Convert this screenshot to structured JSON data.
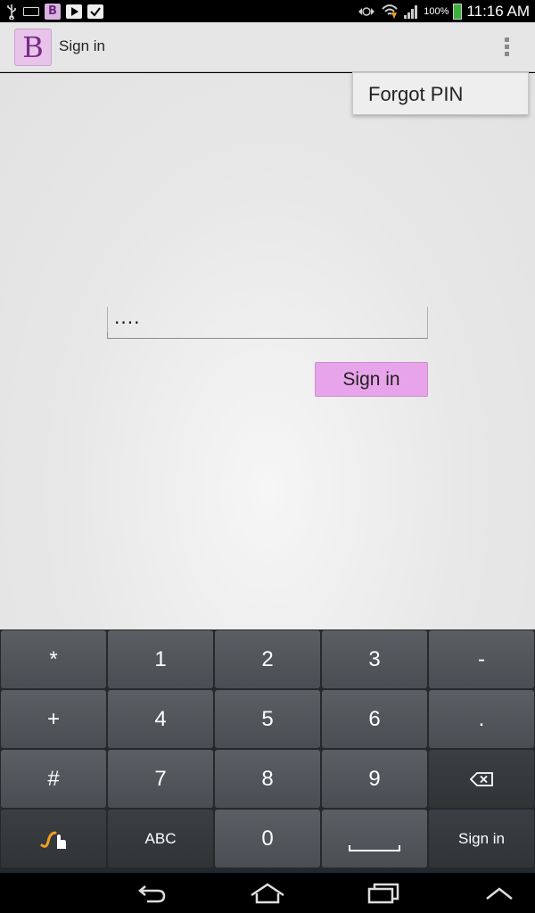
{
  "status_bar": {
    "battery_percent": "100%",
    "time": "11:16 AM",
    "icons": [
      "usb-icon",
      "keyboard-icon",
      "app-notification-icon",
      "play-store-icon",
      "store-check-icon",
      "sync-icon",
      "wifi-icon",
      "signal-icon",
      "battery-icon"
    ]
  },
  "action_bar": {
    "title": "Sign in",
    "logo_letter": "B",
    "overflow_icon": "overflow-menu-icon"
  },
  "popup_menu": {
    "items": [
      {
        "label": "Forgot PIN"
      }
    ]
  },
  "form": {
    "pin_value": "····",
    "signin_label": "Sign in",
    "button_color": "#e8a4ea"
  },
  "keyboard": {
    "rows": [
      [
        "*",
        "1",
        "2",
        "3",
        "-"
      ],
      [
        "+",
        "4",
        "5",
        "6",
        "."
      ],
      [
        "#",
        "7",
        "8",
        "9",
        "backspace"
      ],
      [
        "swype",
        "ABC",
        "0",
        "space",
        "Sign in"
      ]
    ],
    "abc_label": "ABC",
    "action_label": "Sign in"
  },
  "nav_bar": {
    "icons": [
      "back-icon",
      "home-icon",
      "recent-apps-icon",
      "hide-keyboard-icon"
    ]
  }
}
